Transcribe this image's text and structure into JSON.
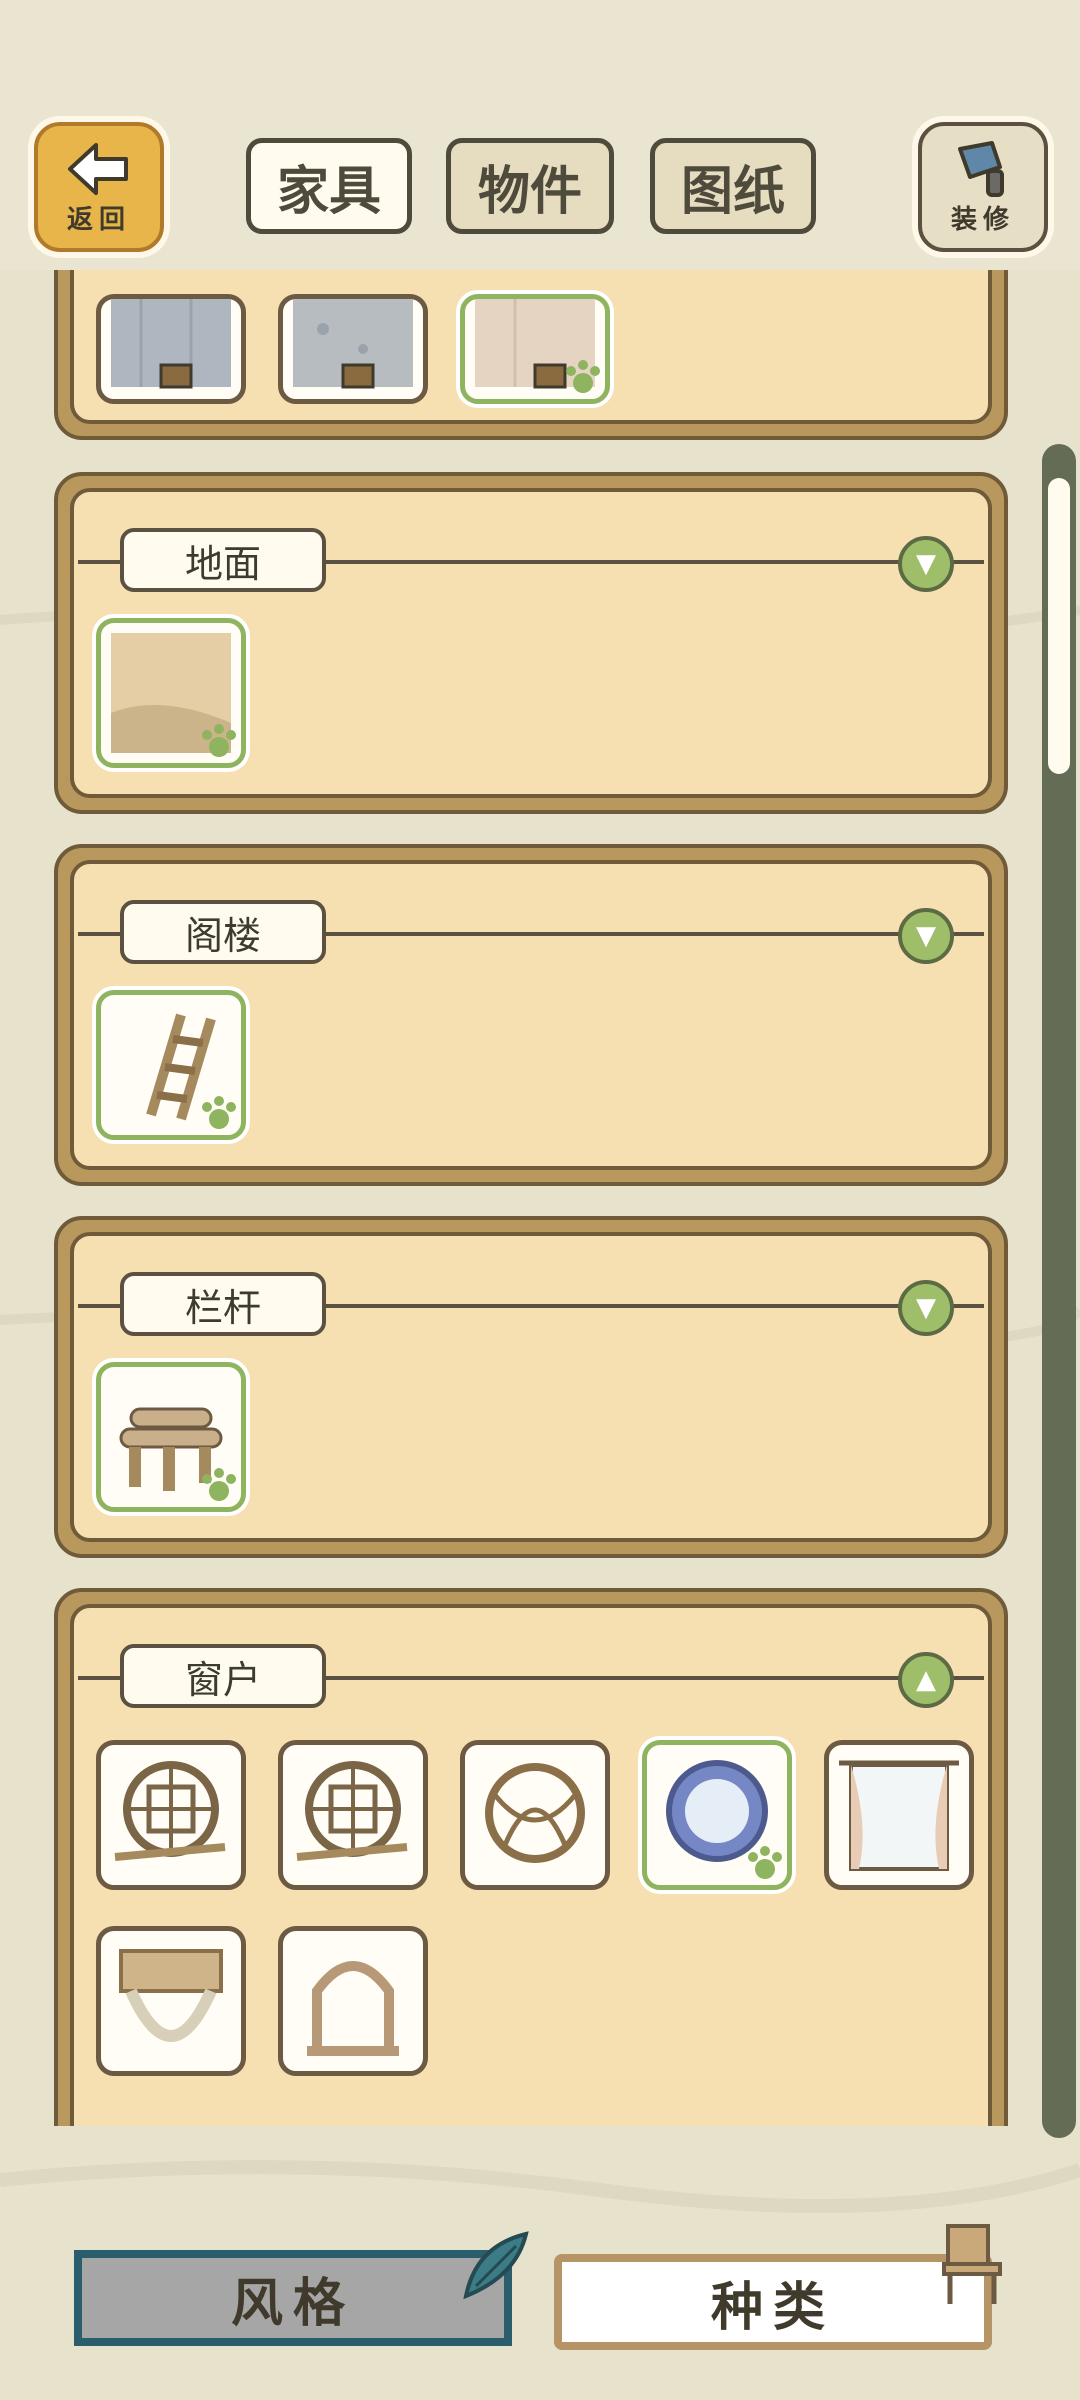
{
  "header": {
    "back_label": "返回",
    "decor_label": "装修",
    "tabs": [
      {
        "label": "家具",
        "active": true
      },
      {
        "label": "物件",
        "active": false
      },
      {
        "label": "图纸",
        "active": false
      }
    ]
  },
  "sections": [
    {
      "title": "地面",
      "expanded": false
    },
    {
      "title": "阁楼",
      "expanded": false
    },
    {
      "title": "栏杆",
      "expanded": false
    },
    {
      "title": "窗户",
      "expanded": true
    }
  ],
  "toggle_icons": {
    "collapsed": "▼",
    "expanded": "▲"
  },
  "bottom": {
    "style_label": "风格",
    "kind_label": "种类"
  },
  "colors": {
    "selected_border": "#8fb45f",
    "accent_green": "#9fbe6a",
    "back_button": "#e7b54a"
  }
}
